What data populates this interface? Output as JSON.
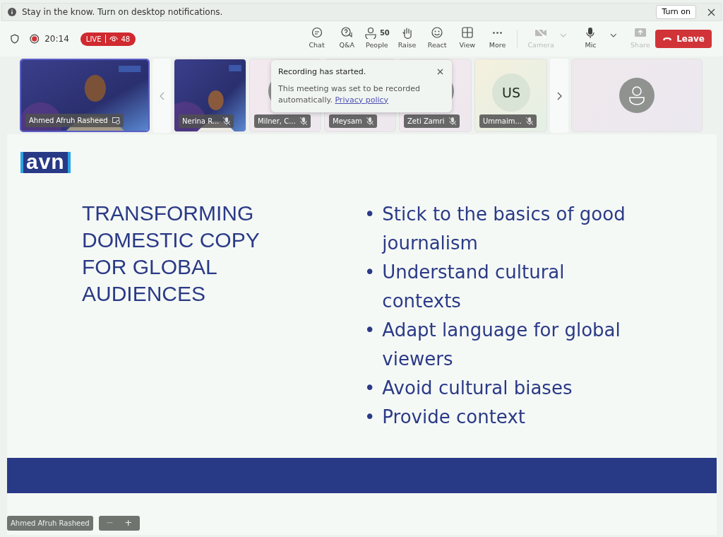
{
  "notification": {
    "text": "Stay in the know. Turn on desktop notifications.",
    "button": "Turn on"
  },
  "status": {
    "time": "20:14",
    "live": "LIVE",
    "viewers": "48"
  },
  "toolbar": [
    {
      "label": "Chat",
      "disabled": false
    },
    {
      "label": "Q&A",
      "disabled": false
    },
    {
      "label": "People",
      "count": "50",
      "disabled": false
    },
    {
      "label": "Raise",
      "disabled": false
    },
    {
      "label": "React",
      "disabled": false
    },
    {
      "label": "View",
      "disabled": false
    },
    {
      "label": "More",
      "disabled": false
    },
    {
      "label": "Camera",
      "disabled": true,
      "dropdown": true
    },
    {
      "label": "Mic",
      "disabled": false,
      "dropdown": true
    },
    {
      "label": "Share",
      "disabled": true
    }
  ],
  "leave_button": "Leave",
  "participants": [
    {
      "name": "Ahmed Afruh Rasheed",
      "kind": "video",
      "selected": true,
      "muted": false,
      "sharing": true
    },
    {
      "name": "Nerina R...",
      "kind": "video",
      "selected": false,
      "muted": true,
      "sharing": false
    },
    {
      "name": "Milner, C...",
      "kind": "avatar",
      "selected": false,
      "muted": true,
      "sharing": false
    },
    {
      "name": "Meysam",
      "kind": "covered",
      "selected": false,
      "muted": true,
      "sharing": false
    },
    {
      "name": "Zeti Zamri",
      "kind": "avatar",
      "selected": false,
      "muted": true,
      "sharing": false
    },
    {
      "name": "Ummaim...",
      "kind": "initials",
      "initials": "US",
      "selected": false,
      "muted": true,
      "sharing": false
    }
  ],
  "toast": {
    "title": "Recording has started.",
    "body": "This meeting was set to be recorded automatically.",
    "link": "Privacy policy"
  },
  "slide": {
    "logo": "avn",
    "title": "TRANSFORMING DOMESTIC COPY FOR GLOBAL AUDIENCES",
    "bullets": [
      {
        "marker": "•",
        "text": "Stick to the basics of good journalism"
      },
      {
        "marker": "•",
        "text": "Understand cultural contexts"
      },
      {
        "marker": "•",
        "text": "Adapt language for global viewers"
      },
      {
        "marker": "•",
        "text": "Avoid cultural biases"
      },
      {
        "marker": "•",
        "text": "Provide context"
      }
    ]
  },
  "presenter_label": "Ahmed Afruh Rasheed",
  "zoom_controls": [
    "−",
    "+"
  ]
}
